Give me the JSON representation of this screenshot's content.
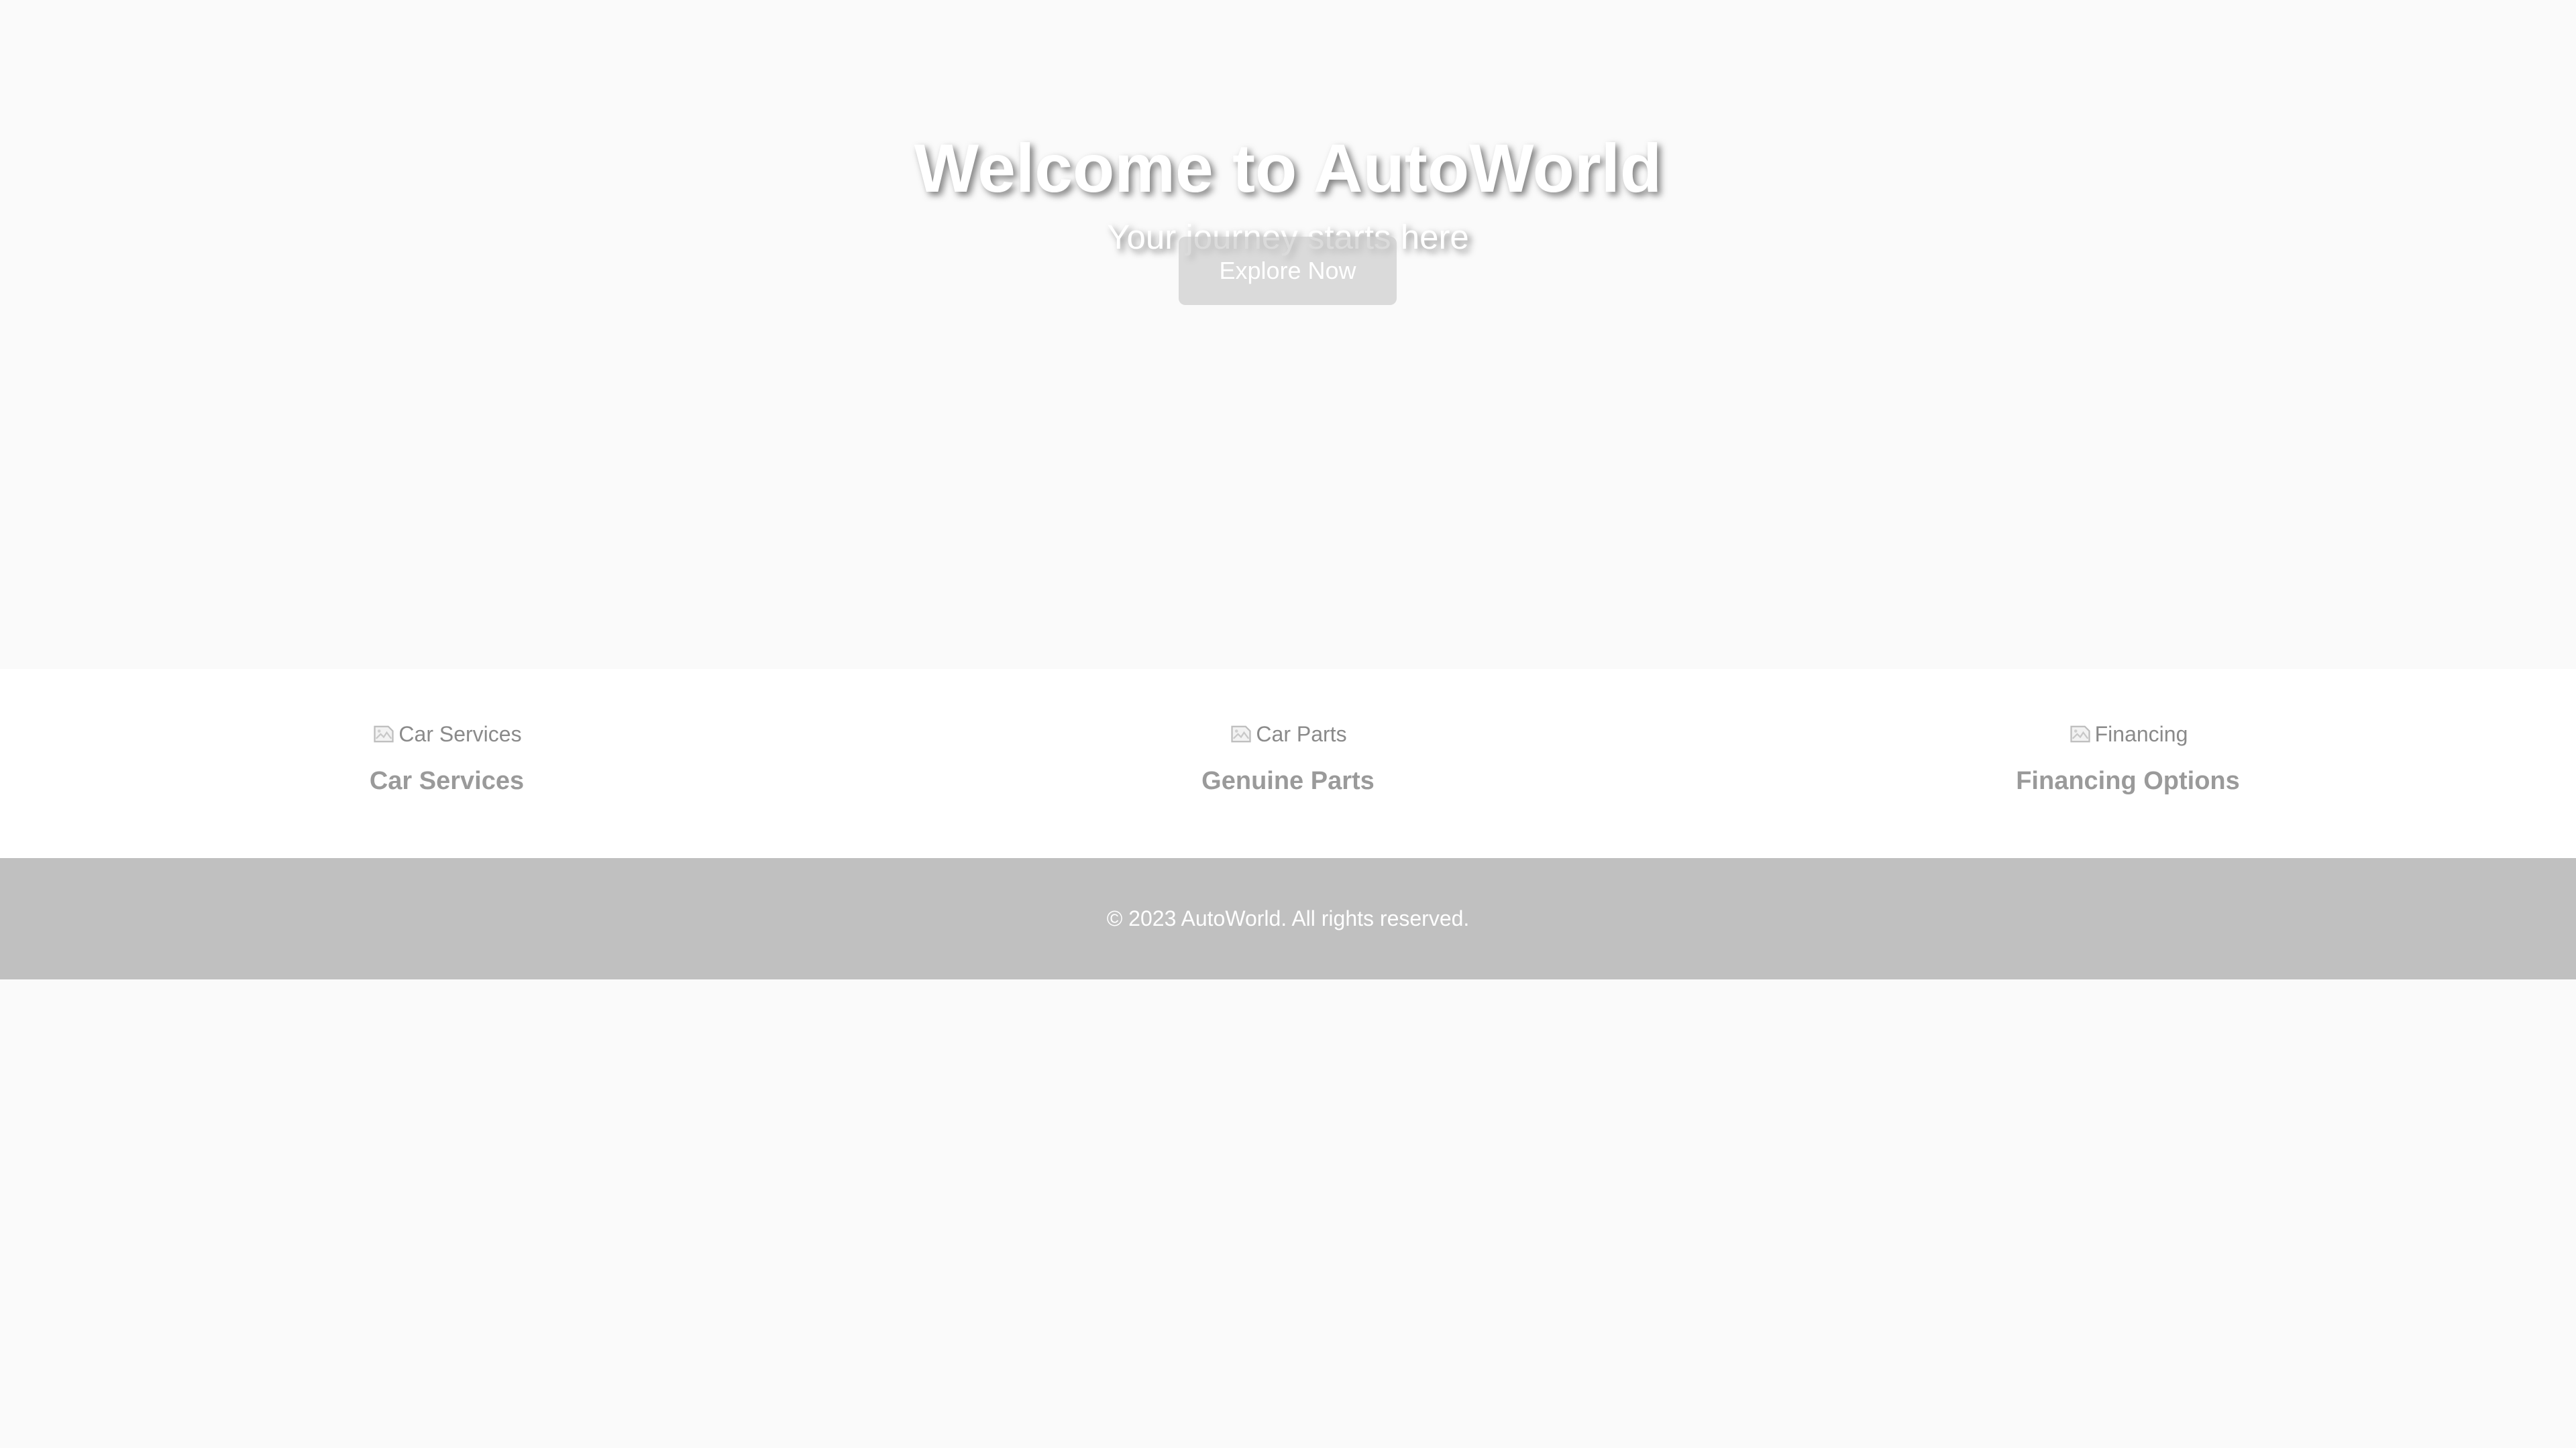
{
  "hero": {
    "title": "Welcome to AutoWorld",
    "subtitle": "Your journey starts here",
    "cta_label": "Explore Now"
  },
  "features": [
    {
      "image_alt": "Car Services",
      "title": "Car Services",
      "icon": "broken-image-icon"
    },
    {
      "image_alt": "Car Parts",
      "title": "Genuine Parts",
      "icon": "broken-image-icon"
    },
    {
      "image_alt": "Financing",
      "title": "Financing Options",
      "icon": "broken-image-icon"
    }
  ],
  "footer": {
    "copyright": "© 2023 AutoWorld. All rights reserved."
  },
  "colors": {
    "background": "#fafafa",
    "features_background": "#ffffff",
    "footer_background": "#c0c0c0",
    "button_background": "#cdcdcd",
    "hero_text": "#ffffff",
    "feature_title": "#9a9a9a"
  }
}
